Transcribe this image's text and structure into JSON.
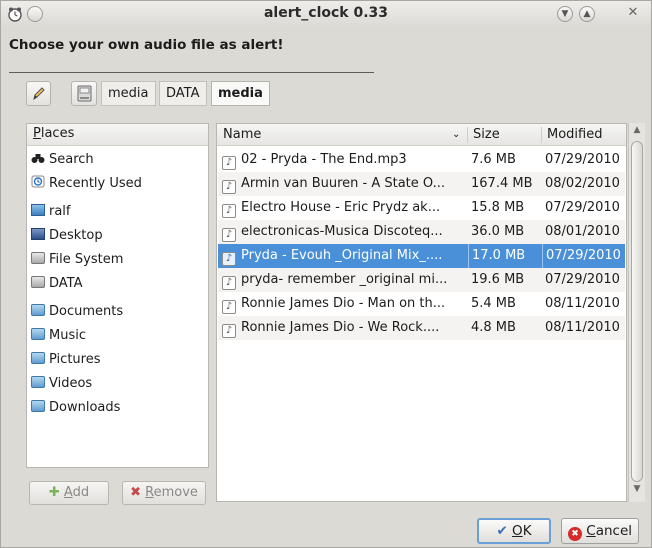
{
  "window": {
    "title": "alert_clock 0.33",
    "prompt": "Choose your own audio file as alert!"
  },
  "pathbar": {
    "crumbs": [
      {
        "label": "media"
      },
      {
        "label": "DATA"
      },
      {
        "label": "media"
      }
    ]
  },
  "places": {
    "header_prefix": "P",
    "header_rest": "laces",
    "items": [
      {
        "label": "Search",
        "icon": "binoculars-icon"
      },
      {
        "label": "Recently Used",
        "icon": "clock-icon"
      },
      {
        "label": "ralf",
        "icon": "home-folder-icon"
      },
      {
        "label": "Desktop",
        "icon": "desktop-icon"
      },
      {
        "label": "File System",
        "icon": "drive-icon"
      },
      {
        "label": "DATA",
        "icon": "drive-icon"
      },
      {
        "label": "Documents",
        "icon": "folder-icon"
      },
      {
        "label": "Music",
        "icon": "folder-icon"
      },
      {
        "label": "Pictures",
        "icon": "folder-icon"
      },
      {
        "label": "Videos",
        "icon": "folder-icon"
      },
      {
        "label": "Downloads",
        "icon": "folder-icon"
      }
    ],
    "add_mnemonic": "A",
    "add_rest": "dd",
    "remove_mnemonic": "R",
    "remove_rest": "emove"
  },
  "files": {
    "columns": {
      "name": "Name",
      "size": "Size",
      "modified": "Modified"
    },
    "rows": [
      {
        "name": "02 - Pryda - The End.mp3",
        "size": "7.6 MB",
        "modified": "07/29/2010"
      },
      {
        "name": "Armin van Buuren - A State O...",
        "size": "167.4 MB",
        "modified": "08/02/2010"
      },
      {
        "name": "Electro House - Eric Prydz ak...",
        "size": "15.8 MB",
        "modified": "07/29/2010"
      },
      {
        "name": "electronicas-Musica Discoteq...",
        "size": "36.0 MB",
        "modified": "08/01/2010"
      },
      {
        "name": "Pryda - Evouh _Original Mix_....",
        "size": "17.0 MB",
        "modified": "07/29/2010"
      },
      {
        "name": "pryda- remember _original mi...",
        "size": "19.6 MB",
        "modified": "07/29/2010"
      },
      {
        "name": "Ronnie James Dio - Man on th...",
        "size": "5.4 MB",
        "modified": "08/11/2010"
      },
      {
        "name": "Ronnie James Dio - We Rock....",
        "size": "4.8 MB",
        "modified": "08/11/2010"
      }
    ],
    "selected_index": 4
  },
  "buttons": {
    "ok_mnemonic": "O",
    "ok_rest": "K",
    "cancel_mnemonic": "C",
    "cancel_rest": "ancel"
  },
  "colors": {
    "selection": "#4a90d9",
    "window_bg": "#dcdad5",
    "cancel_icon": "#d62b2b",
    "ok_icon": "#3b6fb5"
  }
}
